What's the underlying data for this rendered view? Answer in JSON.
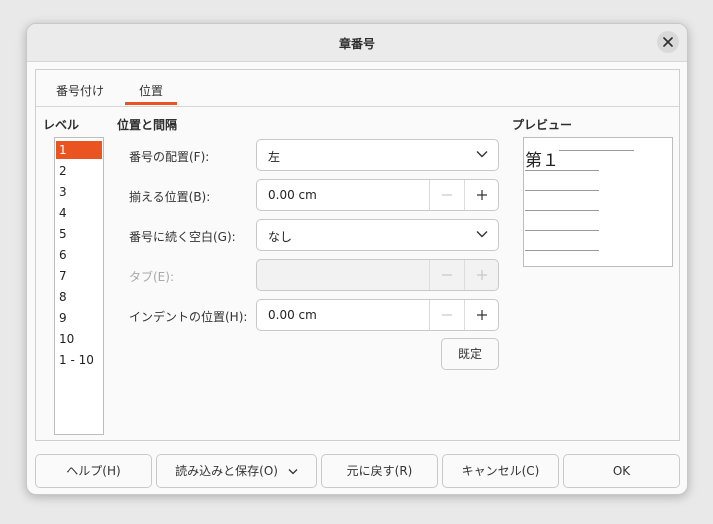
{
  "window": {
    "title": "章番号"
  },
  "tabs": [
    {
      "label": "番号付け",
      "active": false
    },
    {
      "label": "位置",
      "active": true
    }
  ],
  "level": {
    "heading": "レベル",
    "items": [
      "1",
      "2",
      "3",
      "4",
      "5",
      "6",
      "7",
      "8",
      "9",
      "10",
      "1 - 10"
    ],
    "selected": "1"
  },
  "position": {
    "heading": "位置と間隔",
    "alignment": {
      "label": "番号の配置(F):",
      "value": "左"
    },
    "aligned_at": {
      "label": "揃える位置(B):",
      "value": "0.00 cm"
    },
    "followed_by": {
      "label": "番号に続く空白(G):",
      "value": "なし"
    },
    "tab_stop": {
      "label": "タブ(E):",
      "value": ""
    },
    "indent_at": {
      "label": "インデントの位置(H):",
      "value": "0.00 cm"
    },
    "default_label": "既定"
  },
  "preview": {
    "heading": "プレビュー",
    "number_text": "第１"
  },
  "footer": {
    "help": "ヘルプ(H)",
    "load_save": "読み込みと保存(O)",
    "reset": "元に戻す(R)",
    "cancel": "キャンセル(C)",
    "ok": "OK"
  },
  "colors": {
    "accent": "#e95420"
  }
}
